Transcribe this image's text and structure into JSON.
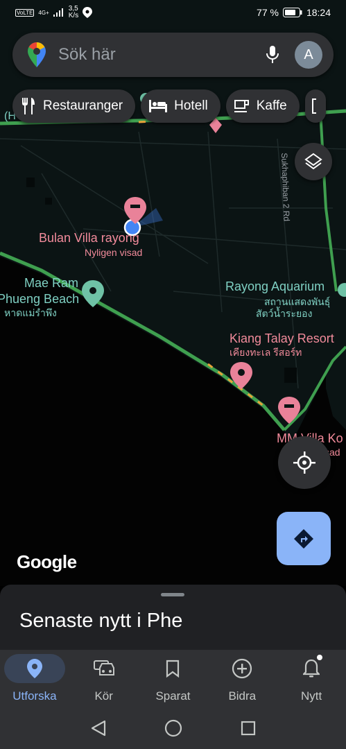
{
  "status_bar": {
    "network_volte": "VoLTE",
    "network_type": "4G+",
    "speed_value": "3,5",
    "speed_unit": "K/s",
    "battery": "77 %",
    "time": "18:24"
  },
  "search": {
    "placeholder": "Sök här",
    "avatar_initial": "A"
  },
  "chips": [
    {
      "label": "Restauranger",
      "icon": "fork-knife-icon"
    },
    {
      "label": "Hotell",
      "icon": "bed-icon"
    },
    {
      "label": "Kaffe",
      "icon": "coffee-icon"
    }
  ],
  "map": {
    "labels": {
      "bulan_villa": "Bulan Villa rayong",
      "bulan_villa_sub": "Nyligen visad",
      "mae_ram_1": "Mae Ram",
      "mae_ram_2": "Phueng Beach",
      "mae_ram_thai": "หาดแม่รำพึง",
      "rayong_aquarium": "Rayong Aquarium",
      "rayong_aquarium_thai_1": "สถานแสดงพันธุ์",
      "rayong_aquarium_thai_2": "สัตว์น้ำระยอง",
      "kiang_talay": "Kiang Talay Resort",
      "kiang_talay_thai": "เคียงทะเล รีสอร์ท",
      "mm_villa": "MM Villa Ko",
      "road_label": "Sukhaphiban 2 Rd",
      "partial_left": "(H",
      "partial_mm_sub": "sad"
    },
    "colors": {
      "land": "#0b1414",
      "sea": "#030303",
      "traffic_green": "#3f9f4f",
      "traffic_orange": "#e8a33a",
      "pink_pin": "#e98299",
      "teal_pin": "#6fc2a6",
      "location_blue": "#4285f4"
    }
  },
  "google_logo": "Google",
  "sheet": {
    "title": "Senaste nytt i Phe"
  },
  "bottom_nav": [
    {
      "label": "Utforska",
      "icon": "location-pin-icon",
      "active": true
    },
    {
      "label": "Kör",
      "icon": "car-icon",
      "active": false
    },
    {
      "label": "Sparat",
      "icon": "bookmark-icon",
      "active": false
    },
    {
      "label": "Bidra",
      "icon": "add-circle-icon",
      "active": false
    },
    {
      "label": "Nytt",
      "icon": "bell-icon",
      "active": false
    }
  ]
}
